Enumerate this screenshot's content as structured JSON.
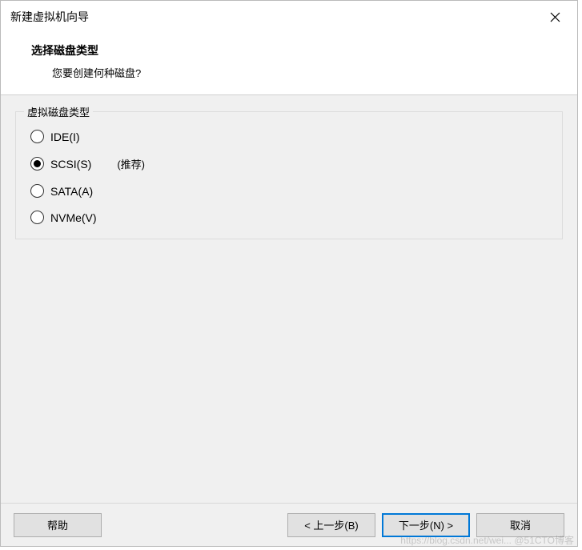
{
  "titlebar": {
    "title": "新建虚拟机向导"
  },
  "header": {
    "title": "选择磁盘类型",
    "subtitle": "您要创建何种磁盘?"
  },
  "group": {
    "label": "虚拟磁盘类型",
    "options": [
      {
        "label": "IDE(I)",
        "hint": "",
        "selected": false
      },
      {
        "label": "SCSI(S)",
        "hint": "(推荐)",
        "selected": true
      },
      {
        "label": "SATA(A)",
        "hint": "",
        "selected": false
      },
      {
        "label": "NVMe(V)",
        "hint": "",
        "selected": false
      }
    ]
  },
  "buttons": {
    "help": "帮助",
    "back": "< 上一步(B)",
    "next": "下一步(N) >",
    "cancel": "取消"
  },
  "watermark": "https://blog.csdn.net/wei... @51CTO博客"
}
